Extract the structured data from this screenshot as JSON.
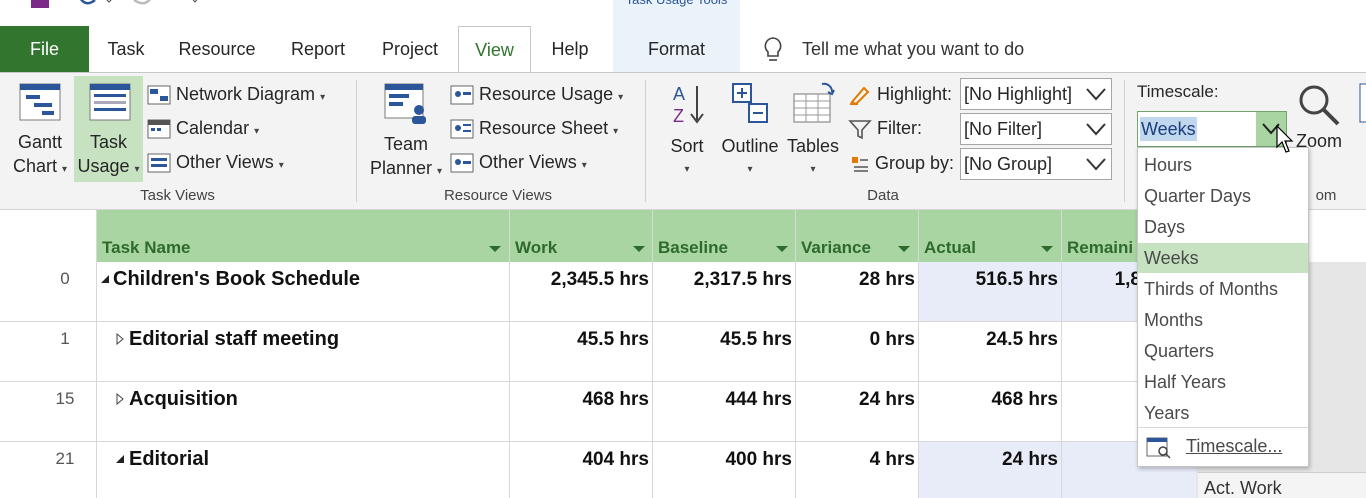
{
  "contextual_title": "Task Usage Tools",
  "tabs": [
    {
      "label": "File"
    },
    {
      "label": "Task"
    },
    {
      "label": "Resource"
    },
    {
      "label": "Report"
    },
    {
      "label": "Project"
    },
    {
      "label": "View"
    },
    {
      "label": "Help"
    },
    {
      "label": "Format"
    }
  ],
  "tell_me": "Tell me what you want to do",
  "task_views": {
    "gantt_l1": "Gantt",
    "gantt_l2": "Chart",
    "usage_l1": "Task",
    "usage_l2": "Usage",
    "network": "Network Diagram",
    "calendar": "Calendar",
    "other": "Other Views",
    "label": "Task Views"
  },
  "resource_views": {
    "planner_l1": "Team",
    "planner_l2": "Planner",
    "usage": "Resource Usage",
    "sheet": "Resource Sheet",
    "other": "Other Views",
    "label": "Resource Views"
  },
  "data_group": {
    "sort": "Sort",
    "outline": "Outline",
    "tables": "Tables",
    "highlight_label": "Highlight:",
    "highlight_value": "[No Highlight]",
    "filter_label": "Filter:",
    "filter_value": "[No Filter]",
    "groupby_label": "Group by:",
    "groupby_value": "[No Group]",
    "label": "Data"
  },
  "zoom": {
    "timescale_label": "Timescale:",
    "timescale_value": "Weeks",
    "zoom_label": "Zoom",
    "group_label_tail": "om"
  },
  "timescale_options": [
    "Hours",
    "Quarter Days",
    "Days",
    "Weeks",
    "Thirds of Months",
    "Months",
    "Quarters",
    "Half Years",
    "Years"
  ],
  "timescale_more": "Timescale...",
  "columns": [
    "Task Name",
    "Work",
    "Baseline",
    "Variance",
    "Actual",
    "Remaini"
  ],
  "rows": [
    {
      "id": "0",
      "name": "Children's Book Schedule",
      "work": "2,345.5 hrs",
      "baseline": "2,317.5 hrs",
      "variance": "28 hrs",
      "actual": "516.5 hrs",
      "remaining": "1,8"
    },
    {
      "id": "1",
      "name": "Editorial staff meeting",
      "work": "45.5 hrs",
      "baseline": "45.5 hrs",
      "variance": "0 hrs",
      "actual": "24.5 hrs",
      "remaining": ""
    },
    {
      "id": "15",
      "name": "Acquisition",
      "work": "468 hrs",
      "baseline": "444 hrs",
      "variance": "24 hrs",
      "actual": "468 hrs",
      "remaining": ""
    },
    {
      "id": "21",
      "name": "Editorial",
      "work": "404 hrs",
      "baseline": "400 hrs",
      "variance": "4 hrs",
      "actual": "24 hrs",
      "remaining": ""
    }
  ],
  "detail_label": "Act. Work"
}
